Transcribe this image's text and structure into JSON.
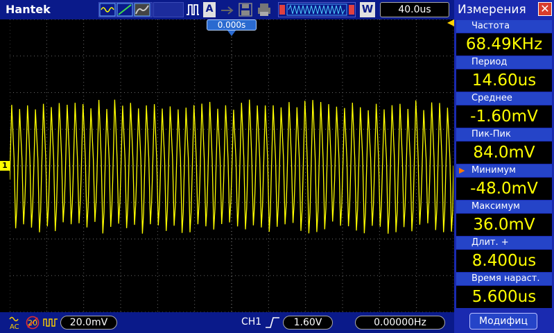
{
  "app": {
    "brand": "Hantek"
  },
  "toolbar": {
    "auto_label": "A",
    "w_label": "W",
    "timebase": "40.0us"
  },
  "trigger_position": "0.000s",
  "channel_marker": "1",
  "measure_panel": {
    "title": "Измерения",
    "close_label": "✕",
    "items": [
      {
        "label": "Частота",
        "value": "68.49KHz"
      },
      {
        "label": "Период",
        "value": "14.60us"
      },
      {
        "label": "Среднее",
        "value": "-1.60mV"
      },
      {
        "label": "Пик-Пик",
        "value": "84.0mV"
      },
      {
        "label": "Минимум",
        "value": "-48.0mV"
      },
      {
        "label": "Максимум",
        "value": "36.0mV"
      },
      {
        "label": "Длит.  +",
        "value": "8.400us"
      },
      {
        "label": "Время  нараст.",
        "value": "5.600us"
      }
    ],
    "selected_index": 4,
    "modify_label": "Модифиц"
  },
  "bottom": {
    "coupling": "AC",
    "bw_limit": "20",
    "volts_div": "20.0mV",
    "trigger_source": "CH1",
    "trigger_level": "1.60V",
    "trigger_freq": "0.00000Hz"
  },
  "colors": {
    "trace": "#ffff00",
    "panel": "#1a2ab0",
    "bar": "#0a1a8a",
    "grid": "#888888"
  }
}
